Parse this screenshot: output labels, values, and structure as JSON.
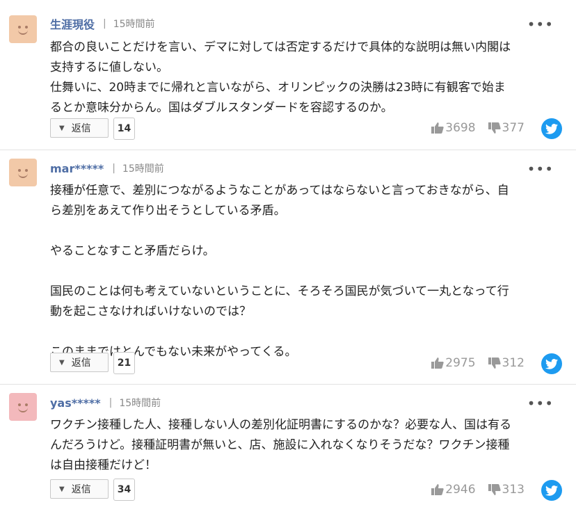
{
  "comments": [
    {
      "name": "生涯現役",
      "sep": "|",
      "time": "15時間前",
      "more": "•••",
      "body": "都合の良いことだけを言い、デマに対しては否定するだけで具体的な説明は無い内閣は\n支持するに値しない。\n仕舞いに、20時までに帰れと言いながら、オリンピックの決勝は23時に有観客で始ま\nるとか意味分からん。国はダブルスタンダードを容認するのか。",
      "reply_label": "返信",
      "reply_count": "14",
      "likes": "3698",
      "dislikes": "377",
      "avatar_color": "#f2c9a8"
    },
    {
      "name": "mar*****",
      "sep": "|",
      "time": "15時間前",
      "more": "•••",
      "body": "接種が任意で、差別につながるようなことがあってはならないと言っておきながら、自\nら差別をあえて作り出そうとしている矛盾。\n\nやることなすこと矛盾だらけ。\n\n国民のことは何も考えていないということに、そろそろ国民が気づいて一丸となって行\n動を起こさなければいけないのでは？\n\nこのままではとんでもない未来がやってくる。",
      "reply_label": "返信",
      "reply_count": "21",
      "likes": "2975",
      "dislikes": "312",
      "avatar_color": "#f2c9a8"
    },
    {
      "name": "yas*****",
      "sep": "|",
      "time": "15時間前",
      "more": "•••",
      "body": "ワクチン接種した人、接種しない人の差別化証明書にするのかな？必要な人、国は有る\nんだろうけど。接種証明書が無いと、店、施設に入れなくなりそうだな？ワクチン接種\nは自由接種だけど！",
      "reply_label": "返信",
      "reply_count": "34",
      "likes": "2946",
      "dislikes": "313",
      "avatar_color": "#f3b9bc"
    }
  ],
  "icons": {
    "like": "thumbs-up-icon",
    "dislike": "thumbs-down-icon",
    "twitter": "twitter-icon",
    "reply_toggle": "caret-down-icon",
    "more": "more-options-icon"
  },
  "colors": {
    "username": "#4f6ea5",
    "twitter": "#1d9bf0",
    "vote_text": "#999999"
  }
}
